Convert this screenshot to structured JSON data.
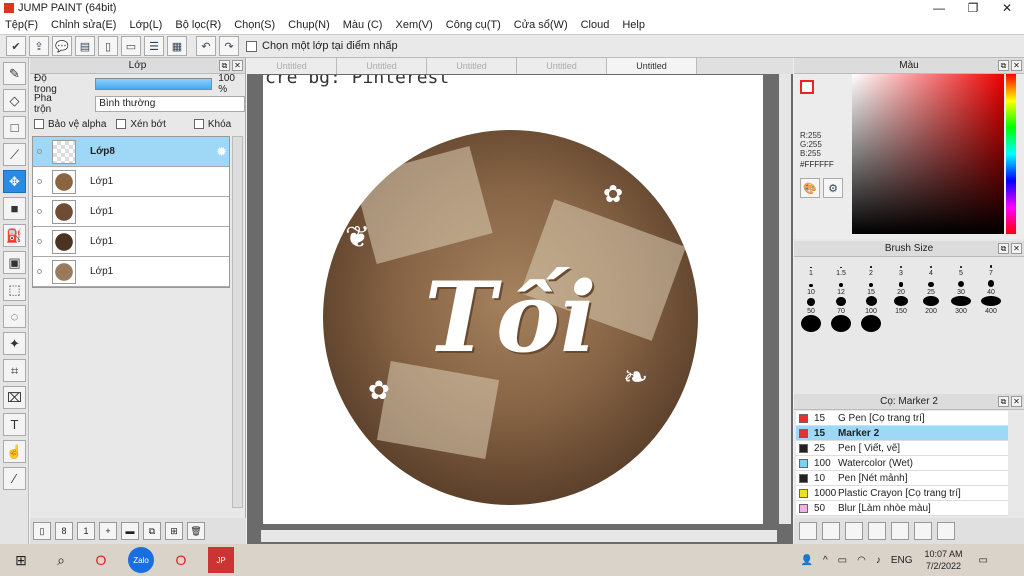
{
  "window": {
    "title": "JUMP PAINT (64bit)",
    "min": "—",
    "restore": "❐",
    "close": "✕"
  },
  "menu": [
    "Tệp(F)",
    "Chỉnh sửa(E)",
    "Lớp(L)",
    "Bộ lọc(R)",
    "Chọn(S)",
    "Chụp(N)",
    "Màu (C)",
    "Xem(V)",
    "Công cụ(T)",
    "Cửa sổ(W)",
    "Cloud",
    "Help"
  ],
  "toolbar": {
    "checkbox_label": "Chọn một lớp tại điểm nhấp"
  },
  "layer_panel": {
    "title": "Lớp",
    "opacity_label": "Độ trong",
    "opacity_value": "100 %",
    "blend_label": "Pha trộn",
    "blend_value": "Bình thường",
    "protect_alpha": "Bảo vệ alpha",
    "clip": "Xén bớt",
    "lock": "Khóa",
    "layers": [
      {
        "name": "Lớp8",
        "selected": true
      },
      {
        "name": "Lớp1"
      },
      {
        "name": "Lớp1"
      },
      {
        "name": "Lớp1"
      },
      {
        "name": "Lớp1"
      }
    ]
  },
  "canvas": {
    "tabs": [
      "Untitled",
      "Untitled",
      "Untitled",
      "Untitled",
      "Untitled"
    ],
    "active_tab": 4,
    "credit_text": "cre bg: Pinterest",
    "main_word": "Tối"
  },
  "color_panel": {
    "title": "Màu",
    "r": "R:255",
    "g": "G:255",
    "b": "B:255",
    "hex": "#FFFFFF"
  },
  "brush_size": {
    "title": "Brush Size",
    "sizes": [
      "1",
      "1.5",
      "2",
      "3",
      "4",
      "5",
      "7",
      "10",
      "12",
      "15",
      "20",
      "25",
      "30",
      "40",
      "50",
      "70",
      "100",
      "150",
      "200",
      "300",
      "400",
      "",
      "",
      ""
    ]
  },
  "brush_panel": {
    "title": "Cọ: Marker 2",
    "items": [
      {
        "num": "15",
        "name": "G Pen [Cọ trang trí]",
        "color": "#e53030"
      },
      {
        "num": "15",
        "name": "Marker 2",
        "color": "#e53030",
        "selected": true
      },
      {
        "num": "25",
        "name": "Pen [ Viết, vẽ]",
        "color": "#222222"
      },
      {
        "num": "100",
        "name": "Watercolor (Wet)",
        "color": "#7fd0f0"
      },
      {
        "num": "10",
        "name": "Pen [Nét mảnh]",
        "color": "#222222"
      },
      {
        "num": "1000",
        "name": "Plastic Crayon [Cọ trang trí]",
        "color": "#f2e020"
      },
      {
        "num": "50",
        "name": "Blur [Làm nhòe màu]",
        "color": "#f0b0e0"
      }
    ]
  },
  "taskbar": {
    "lang": "ENG",
    "time": "10:07 AM",
    "date": "7/2/2022"
  }
}
